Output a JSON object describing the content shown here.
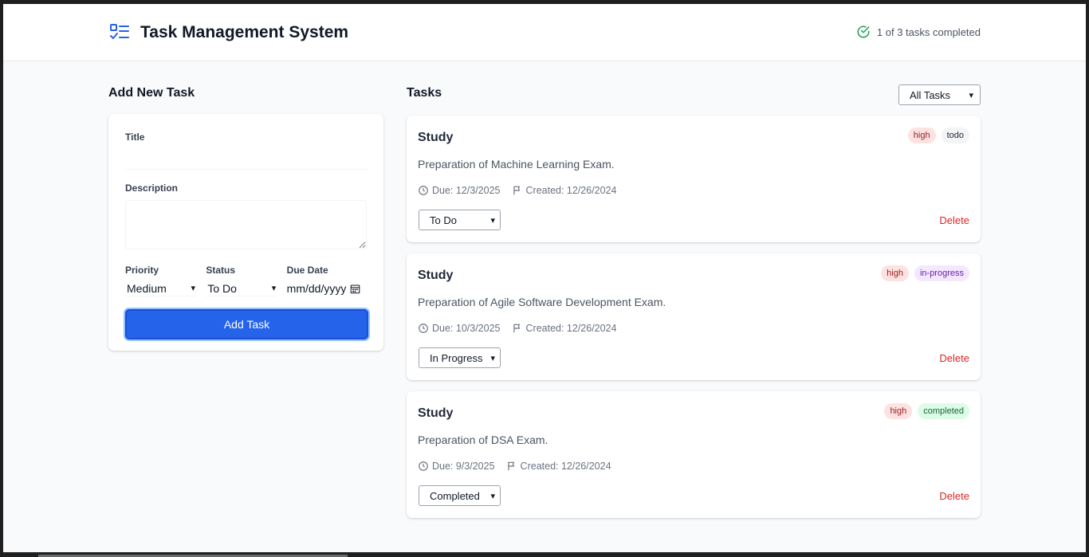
{
  "header": {
    "title": "Task Management System",
    "logo_icon": "list-checks-icon",
    "progress_text": "1 of 3 tasks completed",
    "progress_icon": "check-circle-icon",
    "accent": "#2563eb",
    "success": "#16a34a"
  },
  "form": {
    "heading": "Add New Task",
    "title_label": "Title",
    "title_value": "",
    "description_label": "Description",
    "description_value": "",
    "priority_label": "Priority",
    "priority_value": "Medium",
    "status_label": "Status",
    "status_value": "To Do",
    "due_label": "Due Date",
    "due_placeholder": "mm/dd/yyyy",
    "submit_label": "Add Task"
  },
  "tasks_panel": {
    "heading": "Tasks",
    "filter_value": "All Tasks",
    "delete_label": "Delete",
    "items": [
      {
        "title": "Study",
        "description": "Preparation of Machine Learning Exam.",
        "due": "Due: 12/3/2025",
        "created": "Created: 12/26/2024",
        "priority": "high",
        "status_badge": "todo",
        "status_select": "To Do"
      },
      {
        "title": "Study",
        "description": "Preparation of Agile Software Development Exam.",
        "due": "Due: 10/3/2025",
        "created": "Created: 12/26/2024",
        "priority": "high",
        "status_badge": "in-progress",
        "status_select": "In Progress"
      },
      {
        "title": "Study",
        "description": "Preparation of DSA Exam.",
        "due": "Due: 9/3/2025",
        "created": "Created: 12/26/2024",
        "priority": "high",
        "status_badge": "completed",
        "status_select": "Completed"
      }
    ]
  }
}
